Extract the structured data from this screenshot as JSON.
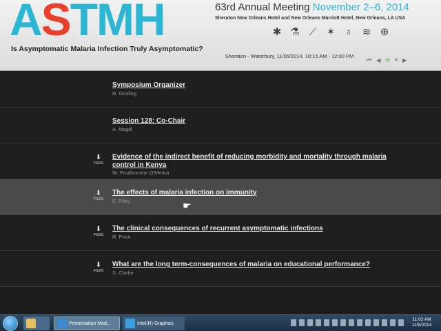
{
  "header": {
    "logo_text": "ASTMH",
    "meeting_title": "63rd Annual Meeting",
    "meeting_dates": "November 2–6, 2014",
    "hotels": "Sheraton New Orleans Hotel and New Orleans Marriott Hotel, New Orleans, LA USA",
    "icons": [
      "insect-icon",
      "microscope-icon",
      "syringe-icon",
      "mosquito-icon",
      "stethoscope-icon",
      "dna-icon",
      "globe-icon"
    ]
  },
  "talk": {
    "title": "Is Asymptomatic Malaria Infection Truly Asymptomatic?",
    "session_info": "Sheraton - Waterbury, 11/05/2014, 10:15 AM - 12:00 PM"
  },
  "player": {
    "controls": [
      "⏮",
      "◀",
      "⟳",
      "⏸",
      "▶"
    ]
  },
  "items": [
    {
      "title": "Symposium Organizer",
      "author": "R. Gosling",
      "files": false
    },
    {
      "title": "Session 128: Co-Chair",
      "author": "A. Magill",
      "files": false
    },
    {
      "title": "Evidence of the indirect benefit of reducing morbidity and mortality through malaria control in Kenya",
      "author": "W. Prudhomme O'Meara",
      "files": true
    },
    {
      "title": "The effects of malaria infection on immunity",
      "author": "E. Riley",
      "files": true
    },
    {
      "title": "The clinical consequences of recurrent asymptomatic infections",
      "author": "R. Price",
      "files": true
    },
    {
      "title": "What are the long term-consequences of malaria on educational performance?",
      "author": "S. Clarke",
      "files": true
    }
  ],
  "files_label": "FILES",
  "taskbar": {
    "buttons": [
      "Presentation Med...",
      "Intel(R) Graphics"
    ],
    "time": "11:02 AM",
    "date": "11/5/2014"
  }
}
